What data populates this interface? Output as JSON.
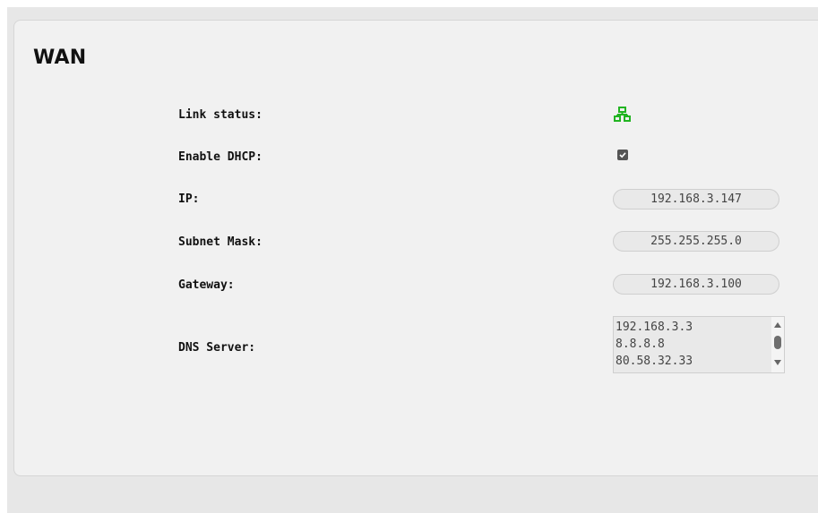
{
  "section": {
    "title": "WAN"
  },
  "rows": {
    "link_status": {
      "label": "Link status:",
      "icon": "network-connected-icon",
      "status_color": "#22b422"
    },
    "enable_dhcp": {
      "label": "Enable DHCP:",
      "checked": true
    },
    "ip": {
      "label": "IP:",
      "value": "192.168.3.147"
    },
    "subnet_mask": {
      "label": "Subnet Mask:",
      "value": "255.255.255.0"
    },
    "gateway": {
      "label": "Gateway:",
      "value": "192.168.3.100"
    },
    "dns_server": {
      "label": "DNS Server:",
      "values": [
        "192.168.3.3",
        "8.8.8.8",
        "80.58.32.33"
      ]
    }
  }
}
